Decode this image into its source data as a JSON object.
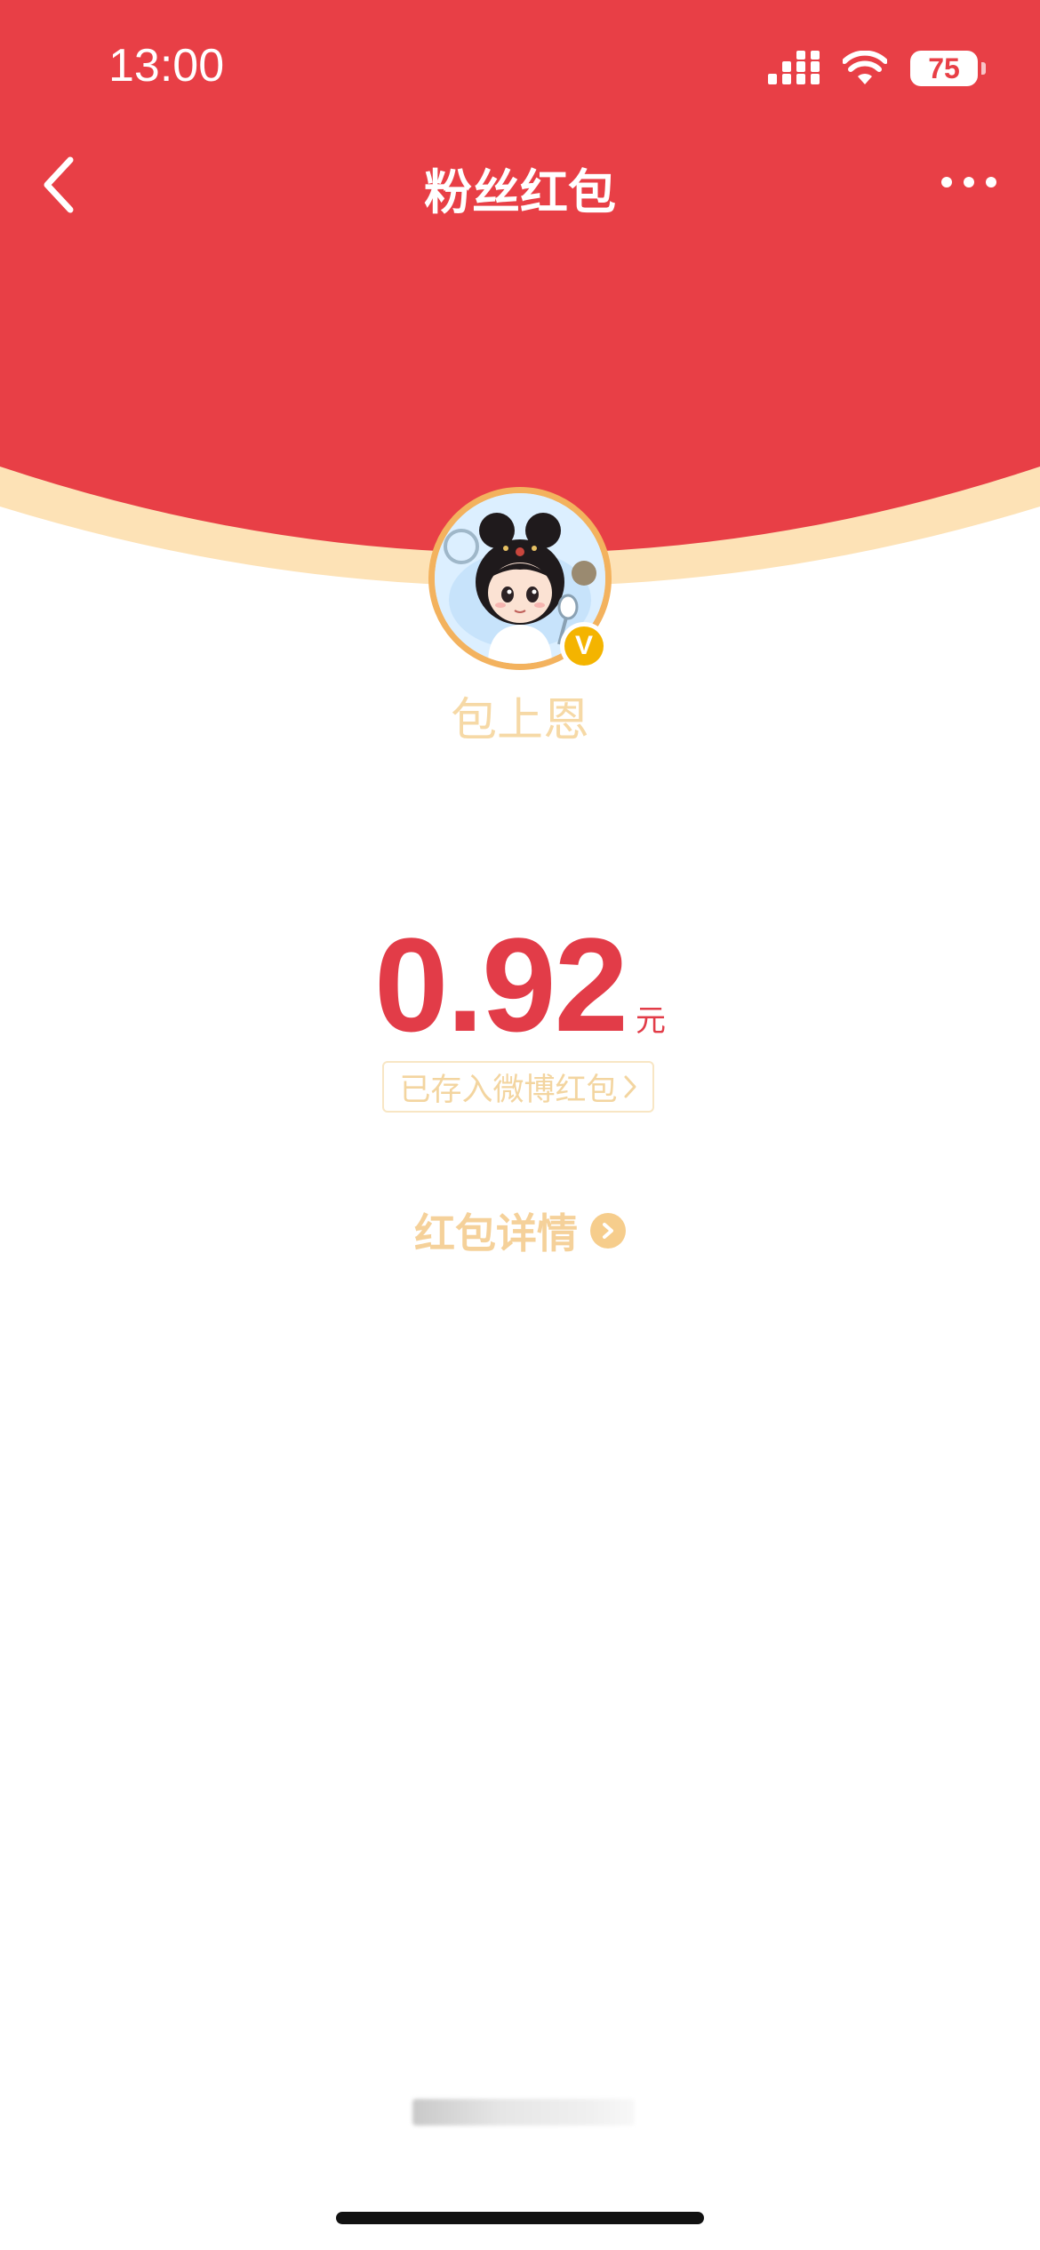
{
  "status_bar": {
    "time": "13:00",
    "battery": "75",
    "signal_icon": "signal-icon",
    "wifi_icon": "wifi-icon"
  },
  "nav": {
    "title": "粉丝红包",
    "back_icon": "back-chevron-icon",
    "more_icon": "more-dots-icon"
  },
  "sender": {
    "name": "包上恩",
    "verified_badge": "V"
  },
  "amount": {
    "value": "0.92",
    "unit": "元"
  },
  "saved_link": {
    "label": "已存入微博红包",
    "icon": "chevron-right-icon"
  },
  "details_link": {
    "label": "红包详情",
    "icon": "arrow-circle-icon"
  },
  "colors": {
    "header_red": "#e83f46",
    "rim_cream": "#fde2b6",
    "amount_red": "#e23c48",
    "gold_text": "#f5d19a"
  }
}
